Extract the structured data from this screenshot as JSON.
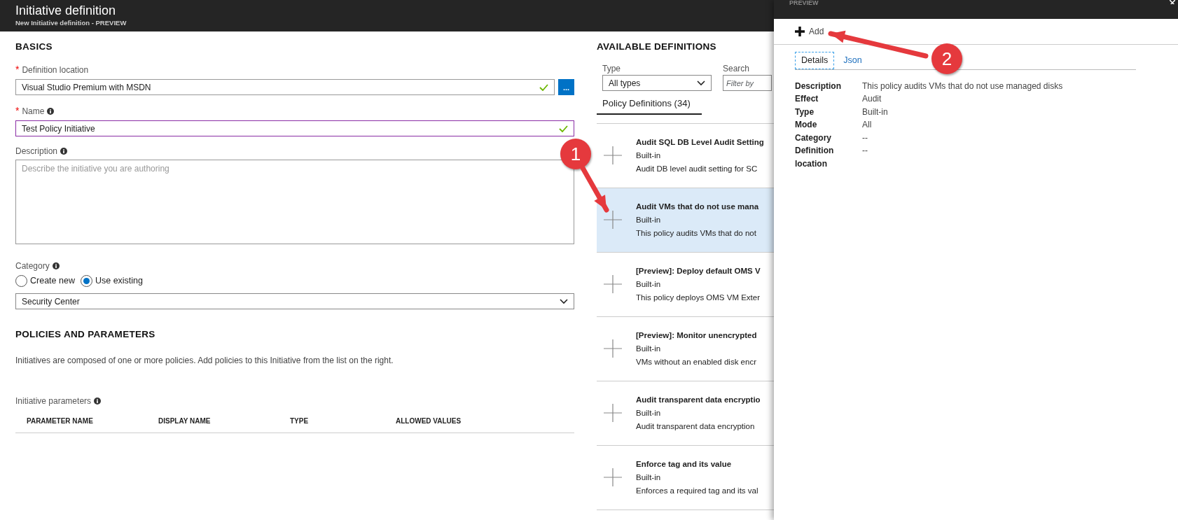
{
  "header": {
    "title": "Initiative definition",
    "subtitle": "New Initiative definition - PREVIEW"
  },
  "basics": {
    "heading": "BASICS",
    "definition_location": {
      "label": "Definition location",
      "required_mark": "*",
      "value": "Visual Studio Premium with MSDN",
      "valid": true,
      "browse_button": "..."
    },
    "name": {
      "label": "Name",
      "required_mark": "*",
      "info": true,
      "value": "Test Policy Initiative",
      "valid": true,
      "focused": true
    },
    "description": {
      "label": "Description",
      "info": true,
      "placeholder": "Describe the initiative you are authoring"
    },
    "category": {
      "label": "Category",
      "info": true,
      "options": [
        {
          "label": "Create new",
          "selected": false
        },
        {
          "label": "Use existing",
          "selected": true
        }
      ],
      "value": "Security Center"
    }
  },
  "policies": {
    "heading": "POLICIES AND PARAMETERS",
    "text": "Initiatives are composed of one or more policies. Add policies to this Initiative from the list on the right.",
    "parameters_label": "Initiative parameters",
    "parameters_info": true,
    "columns": [
      "PARAMETER NAME",
      "DISPLAY NAME",
      "TYPE",
      "ALLOWED VALUES"
    ]
  },
  "available": {
    "heading": "AVAILABLE DEFINITIONS",
    "type_label": "Type",
    "type_value": "All types",
    "search_label": "Search",
    "search_placeholder": "Filter by",
    "tab": "Policy Definitions (34)",
    "items": [
      {
        "title": "Audit SQL DB Level Audit Setting",
        "type": "Built-in",
        "description": "Audit DB level audit setting for SC",
        "selected": false
      },
      {
        "title": "Audit VMs that do not use mana",
        "type": "Built-in",
        "description": "This policy audits VMs that do not",
        "selected": true
      },
      {
        "title": "[Preview]: Deploy default OMS V",
        "type": "Built-in",
        "description": "This policy deploys OMS VM Exter",
        "selected": false
      },
      {
        "title": "[Preview]: Monitor unencrypted",
        "type": "Built-in",
        "description": "VMs without an enabled disk encr",
        "selected": false
      },
      {
        "title": "Audit transparent data encryptio",
        "type": "Built-in",
        "description": "Audit transparent data encryption",
        "selected": false
      },
      {
        "title": "Enforce tag and its value",
        "type": "Built-in",
        "description": "Enforces a required tag and its val",
        "selected": false
      }
    ]
  },
  "preview": {
    "title": "PREVIEW",
    "add_button": "Add",
    "tabs": [
      {
        "label": "Details",
        "selected": true
      },
      {
        "label": "Json",
        "selected": false
      }
    ],
    "details": [
      {
        "key": "Description",
        "value": "This policy audits VMs that do not use managed disks"
      },
      {
        "key": "Effect",
        "value": "Audit"
      },
      {
        "key": "Type",
        "value": "Built-in"
      },
      {
        "key": "Mode",
        "value": "All"
      },
      {
        "key": "Category",
        "value": "--"
      },
      {
        "key": "Definition location",
        "value": "--"
      }
    ]
  },
  "annotations": [
    {
      "number": "1"
    },
    {
      "number": "2"
    }
  ]
}
